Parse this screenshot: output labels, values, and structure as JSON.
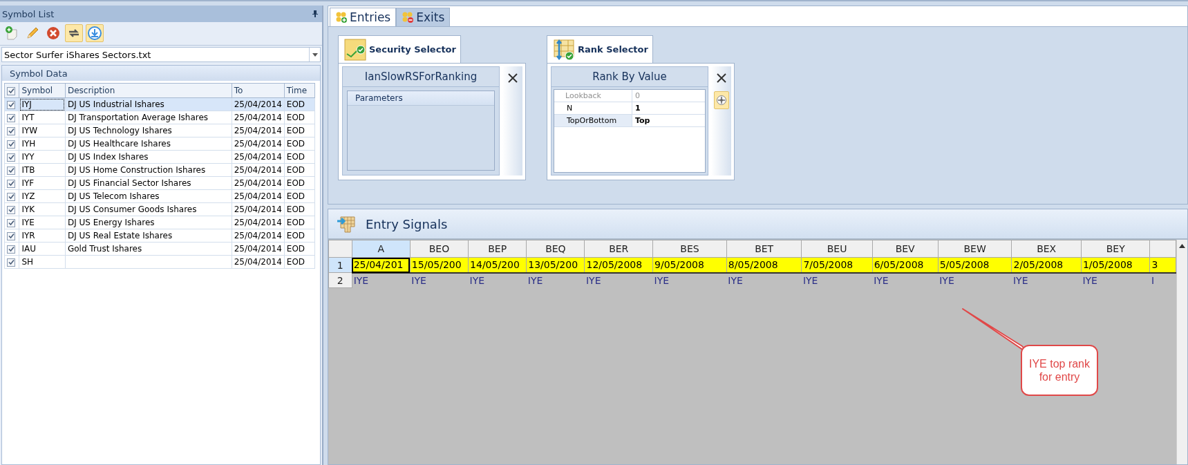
{
  "symbol_list": {
    "title": "Symbol List",
    "file_select": {
      "value": "Sector Surfer iShares Sectors.txt"
    },
    "group_title": "Symbol Data",
    "table": {
      "all_checked": true,
      "columns": [
        "Symbol",
        "Description",
        "To",
        "Time"
      ],
      "rows": [
        {
          "checked": true,
          "selected": true,
          "cells": [
            "IYJ",
            "DJ US Industrial Ishares",
            "25/04/2014",
            "EOD"
          ]
        },
        {
          "checked": true,
          "selected": false,
          "cells": [
            "IYT",
            "DJ Transportation Average Ishares",
            "25/04/2014",
            "EOD"
          ]
        },
        {
          "checked": true,
          "selected": false,
          "cells": [
            "IYW",
            "DJ US Technology Ishares",
            "25/04/2014",
            "EOD"
          ]
        },
        {
          "checked": true,
          "selected": false,
          "cells": [
            "IYH",
            "DJ US Healthcare Ishares",
            "25/04/2014",
            "EOD"
          ]
        },
        {
          "checked": true,
          "selected": false,
          "cells": [
            "IYY",
            "DJ US Index Ishares",
            "25/04/2014",
            "EOD"
          ]
        },
        {
          "checked": true,
          "selected": false,
          "cells": [
            "ITB",
            "DJ US Home Construction Ishares",
            "25/04/2014",
            "EOD"
          ]
        },
        {
          "checked": true,
          "selected": false,
          "cells": [
            "IYF",
            "DJ US Financial Sector Ishares",
            "25/04/2014",
            "EOD"
          ]
        },
        {
          "checked": true,
          "selected": false,
          "cells": [
            "IYZ",
            "DJ US Telecom Ishares",
            "25/04/2014",
            "EOD"
          ]
        },
        {
          "checked": true,
          "selected": false,
          "cells": [
            "IYK",
            "DJ US Consumer Goods Ishares",
            "25/04/2014",
            "EOD"
          ]
        },
        {
          "checked": true,
          "selected": false,
          "cells": [
            "IYE",
            "DJ US Energy Ishares",
            "25/04/2014",
            "EOD"
          ]
        },
        {
          "checked": true,
          "selected": false,
          "cells": [
            "IYR",
            "DJ US Real Estate Ishares",
            "25/04/2014",
            "EOD"
          ]
        },
        {
          "checked": true,
          "selected": false,
          "cells": [
            "IAU",
            "Gold Trust Ishares",
            "25/04/2014",
            "EOD"
          ]
        },
        {
          "checked": true,
          "selected": false,
          "cells": [
            "SH",
            "",
            "25/04/2014",
            "EOD"
          ]
        }
      ]
    }
  },
  "tabs": [
    {
      "label": "Entries",
      "selected": true
    },
    {
      "label": "Exits",
      "selected": false
    }
  ],
  "security_selector": {
    "title": "Security Selector",
    "rule": "IanSlowRSForRanking",
    "parameters_title": "Parameters"
  },
  "rank_selector": {
    "title": "Rank Selector",
    "rule": "Rank By Value",
    "parameters": [
      {
        "name": "Lookback",
        "value": "0",
        "disabled": true
      },
      {
        "name": "N",
        "value": "1",
        "disabled": false
      },
      {
        "name": "TopOrBottom",
        "value": "Top",
        "disabled": false
      }
    ]
  },
  "entry_signals": {
    "title": "Entry Signals",
    "columns": [
      {
        "label": "A",
        "selected": true
      },
      {
        "label": "BEO",
        "selected": false
      },
      {
        "label": "BEP",
        "selected": false
      },
      {
        "label": "BEQ",
        "selected": false
      },
      {
        "label": "BER",
        "selected": false
      },
      {
        "label": "BES",
        "selected": false
      },
      {
        "label": "BET",
        "selected": false
      },
      {
        "label": "BEU",
        "selected": false
      },
      {
        "label": "BEV",
        "selected": false
      },
      {
        "label": "BEW",
        "selected": false
      },
      {
        "label": "BEX",
        "selected": false
      },
      {
        "label": "BEY",
        "selected": false
      }
    ],
    "rows": [
      {
        "number": "1",
        "selected": true,
        "highlighted": true,
        "cells": [
          "25/04/201",
          "15/05/200",
          "14/05/200",
          "13/05/200",
          "12/05/2008",
          "9/05/2008",
          "8/05/2008",
          "7/05/2008",
          "6/05/2008",
          "5/05/2008",
          "2/05/2008",
          "1/05/2008",
          "3"
        ]
      },
      {
        "number": "2",
        "selected": false,
        "highlighted": false,
        "cells": [
          "IYE",
          "IYE",
          "IYE",
          "IYE",
          "IYE",
          "IYE",
          "IYE",
          "IYE",
          "IYE",
          "IYE",
          "IYE",
          "IYE",
          "I"
        ]
      }
    ],
    "callout": "IYE top rank for entry"
  }
}
